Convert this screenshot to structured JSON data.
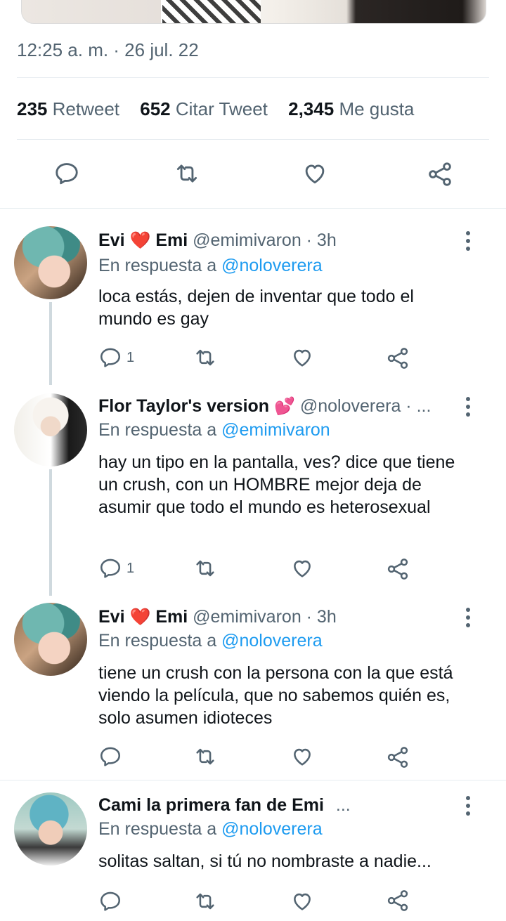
{
  "tweet": {
    "timestamp": "12:25 a. m. · 26 jul. 22",
    "stats": {
      "retweets_count": "235",
      "retweets_label": "Retweet",
      "quotes_count": "652",
      "quotes_label": "Citar Tweet",
      "likes_count": "2,345",
      "likes_label": "Me gusta"
    }
  },
  "icons": {
    "reply": "reply-icon",
    "retweet": "retweet-icon",
    "like": "heart-icon",
    "share": "share-icon",
    "more": "more-vertical-icon"
  },
  "colors": {
    "link": "#1d9bf0",
    "secondary_text": "#536471",
    "heart_emoji": "#e0245e",
    "divider": "#e6ecf0"
  },
  "replies": [
    {
      "name_prefix": "Evi",
      "name_emoji": "❤️",
      "name_suffix": "Emi",
      "meta": "@emimivaron · 3h",
      "reply_prefix": "En respuesta a",
      "reply_handle": "@noloverera",
      "text": "loca estás, dejen de inventar que todo el mundo es gay",
      "reply_count": "1"
    },
    {
      "name_prefix": "Flor Taylor's version",
      "name_emoji": "💕",
      "name_suffix": "",
      "meta": "@noloverera · ...",
      "reply_prefix": "En respuesta a",
      "reply_handle": "@emimivaron",
      "text": "hay un tipo en la pantalla, ves? dice que tiene un crush, con un HOMBRE mejor deja de asumir que todo el mundo es heterosexual",
      "reply_count": "1"
    },
    {
      "name_prefix": "Evi",
      "name_emoji": "❤️",
      "name_suffix": "Emi",
      "meta": "@emimivaron · 3h",
      "reply_prefix": "En respuesta a",
      "reply_handle": "@noloverera",
      "text": "tiene un crush con la persona con la que está viendo la película, que no sabemos quién es, solo asumen idioteces",
      "reply_count": ""
    },
    {
      "name_prefix": "Cami la primera fan de Emi",
      "name_emoji": "",
      "name_suffix": "",
      "meta": "...",
      "reply_prefix": "En respuesta a",
      "reply_handle": "@noloverera",
      "text": "solitas saltan, si tú no nombraste a nadie...",
      "reply_count": ""
    }
  ]
}
